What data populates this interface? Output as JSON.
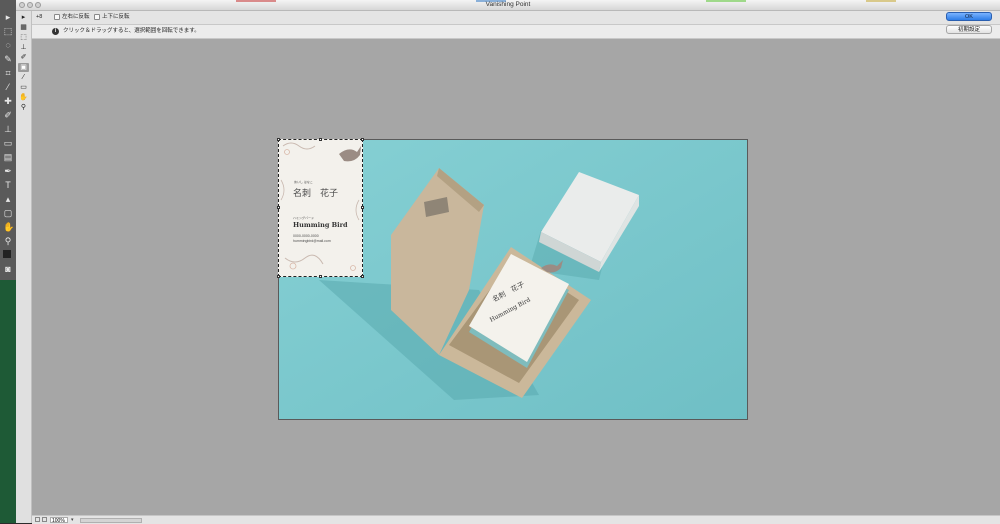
{
  "window": {
    "title": "Vanishing Point"
  },
  "options": {
    "brush_size_label": "+8",
    "flip_horizontal_label": "左右に反転",
    "flip_vertical_label": "上下に反転"
  },
  "info": {
    "hint": "クリック＆ドラッグすると、選択範囲を回転できます。"
  },
  "buttons": {
    "ok": "OK",
    "reset": "初期設定"
  },
  "status": {
    "zoom": "100%"
  },
  "card": {
    "furigana_name": "めいし はなこ",
    "name": "名刺　花子",
    "furigana_company": "ハミングバード",
    "company": "Humming Bird",
    "line1": "0000-0000-0000",
    "line2": "hummingbird@mail.com"
  },
  "mini_card": {
    "name": "名刺　花子",
    "company": "Humming Bird"
  },
  "colors": {
    "photo_background": "#7cc7cc",
    "canvas_gray": "#a6a6a6",
    "ok_blue": "#2e7de6"
  },
  "tools": {
    "dialog": [
      "edit-plane-icon",
      "create-plane-icon",
      "marquee-icon",
      "stamp-icon",
      "brush-icon",
      "transform-icon",
      "eyedropper-icon",
      "measure-icon",
      "hand-icon",
      "zoom-icon"
    ]
  }
}
